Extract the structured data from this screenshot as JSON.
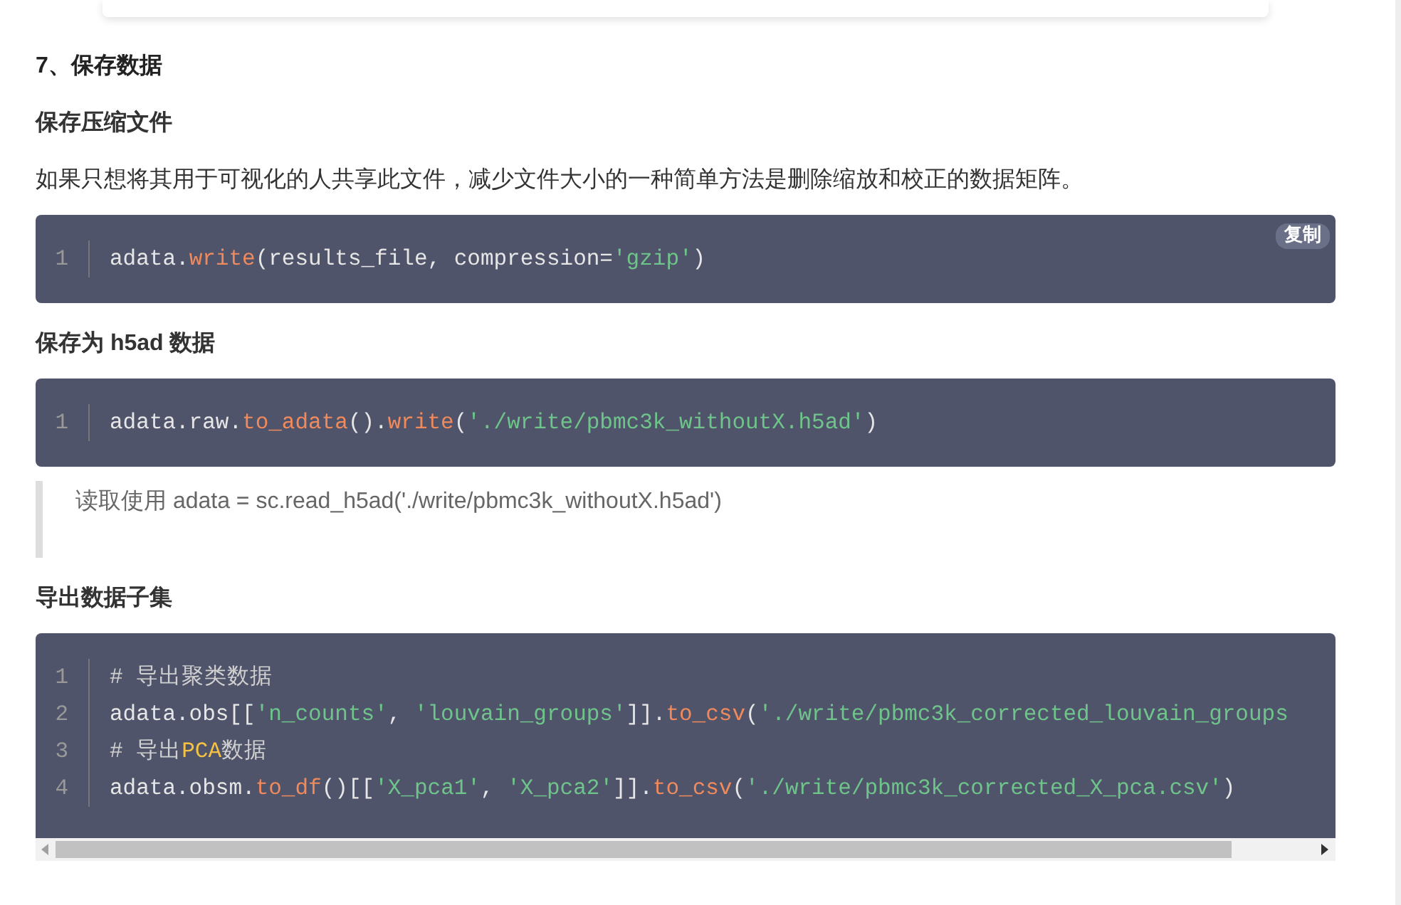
{
  "section_heading": "7、保存数据",
  "blocks": [
    {
      "kind": "subheading",
      "text": "保存压缩文件"
    },
    {
      "kind": "paragraph",
      "text": "如果只想将其用于可视化的人共享此文件，减少文件大小的一种简单方法是删除缩放和校正的数据矩阵。"
    },
    {
      "kind": "code",
      "copy_button": "复制",
      "scrollbar": false,
      "lines": [
        {
          "number": "1",
          "tokens": [
            {
              "kind": "plain",
              "text": "adata."
            },
            {
              "kind": "func",
              "text": "write"
            },
            {
              "kind": "plain",
              "text": "(results_file, compression="
            },
            {
              "kind": "string",
              "text": "'gzip'"
            },
            {
              "kind": "plain",
              "text": ")"
            }
          ]
        }
      ]
    },
    {
      "kind": "subheading",
      "text": "保存为 h5ad 数据"
    },
    {
      "kind": "code",
      "scrollbar": false,
      "lines": [
        {
          "number": "1",
          "tokens": [
            {
              "kind": "plain",
              "text": "adata.raw."
            },
            {
              "kind": "func",
              "text": "to_adata"
            },
            {
              "kind": "plain",
              "text": "()."
            },
            {
              "kind": "func",
              "text": "write"
            },
            {
              "kind": "plain",
              "text": "("
            },
            {
              "kind": "string",
              "text": "'./write/pbmc3k_withoutX.h5ad'"
            },
            {
              "kind": "plain",
              "text": ")"
            }
          ]
        }
      ]
    },
    {
      "kind": "quote",
      "text": "读取使用 adata = sc.read_h5ad('./write/pbmc3k_withoutX.h5ad')"
    },
    {
      "kind": "subheading",
      "text": "导出数据子集"
    },
    {
      "kind": "code",
      "scrollbar": true,
      "lines": [
        {
          "number": "1",
          "tokens": [
            {
              "kind": "comment",
              "text": "# 导出聚类数据"
            }
          ]
        },
        {
          "number": "2",
          "tokens": [
            {
              "kind": "plain",
              "text": "adata.obs[["
            },
            {
              "kind": "string",
              "text": "'n_counts'"
            },
            {
              "kind": "plain",
              "text": ", "
            },
            {
              "kind": "string",
              "text": "'louvain_groups'"
            },
            {
              "kind": "plain",
              "text": "]]."
            },
            {
              "kind": "func",
              "text": "to_csv"
            },
            {
              "kind": "plain",
              "text": "("
            },
            {
              "kind": "string",
              "text": "'./write/pbmc3k_corrected_louvain_groups"
            }
          ]
        },
        {
          "number": "3",
          "tokens": [
            {
              "kind": "comment",
              "text": "# 导出"
            },
            {
              "kind": "keyword",
              "text": "PCA"
            },
            {
              "kind": "comment",
              "text": "数据"
            }
          ]
        },
        {
          "number": "4",
          "tokens": [
            {
              "kind": "plain",
              "text": "adata.obsm."
            },
            {
              "kind": "func",
              "text": "to_df"
            },
            {
              "kind": "plain",
              "text": "()[["
            },
            {
              "kind": "string",
              "text": "'X_pca1'"
            },
            {
              "kind": "plain",
              "text": ", "
            },
            {
              "kind": "string",
              "text": "'X_pca2'"
            },
            {
              "kind": "plain",
              "text": "]]."
            },
            {
              "kind": "func",
              "text": "to_csv"
            },
            {
              "kind": "plain",
              "text": "("
            },
            {
              "kind": "string",
              "text": "'./write/pbmc3k_corrected_X_pca.csv'"
            },
            {
              "kind": "plain",
              "text": ")"
            }
          ]
        }
      ]
    }
  ]
}
